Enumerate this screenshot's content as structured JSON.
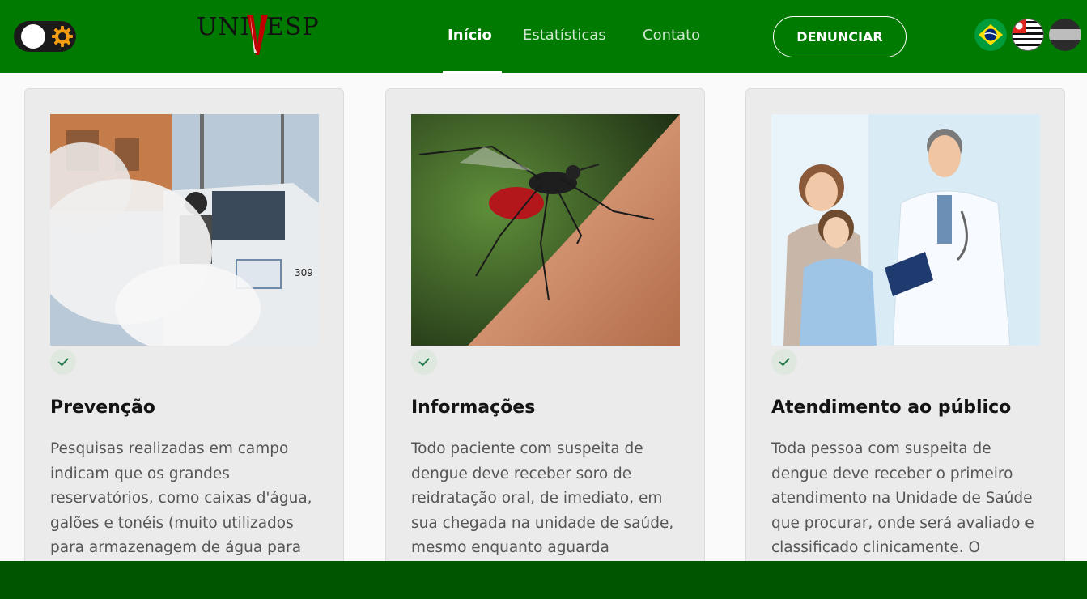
{
  "header": {
    "theme_toggle": {
      "icon": "gear-icon",
      "state": "light"
    },
    "logo_text": {
      "left": "UNI",
      "mark": "V",
      "right": "ESP"
    },
    "nav": [
      {
        "label": "Início",
        "active": true
      },
      {
        "label": "Estatísticas",
        "active": false
      },
      {
        "label": "Contato",
        "active": false
      }
    ],
    "cta_label": "DENUNCIAR",
    "flags": [
      "brazil-flag-icon",
      "sao-paulo-flag-icon",
      "gray-flag-icon"
    ]
  },
  "cards": [
    {
      "image": "fumigation-truck-photo",
      "title": "Prevenção",
      "text": "Pesquisas realizadas em campo indicam que os grandes reservatórios, como caixas d'água, galões e tonéis (muito utilizados para armazenagem de água para"
    },
    {
      "image": "mosquito-photo",
      "title": "Informações",
      "text": "Todo paciente com suspeita de dengue deve receber soro de reidratação oral, de imediato, em sua chegada na unidade de saúde, mesmo enquanto aguarda"
    },
    {
      "image": "doctor-family-photo",
      "title": "Atendimento ao público",
      "text": "Toda pessoa com suspeita de dengue deve receber o primeiro atendimento na Unidade de Saúde que procurar, onde será avaliado e classificado clinicamente. O"
    }
  ],
  "colors": {
    "header_bg": "#007a00",
    "footer_bg": "#005600",
    "card_bg": "#ebebeb",
    "check_color": "#1f7a4a"
  }
}
